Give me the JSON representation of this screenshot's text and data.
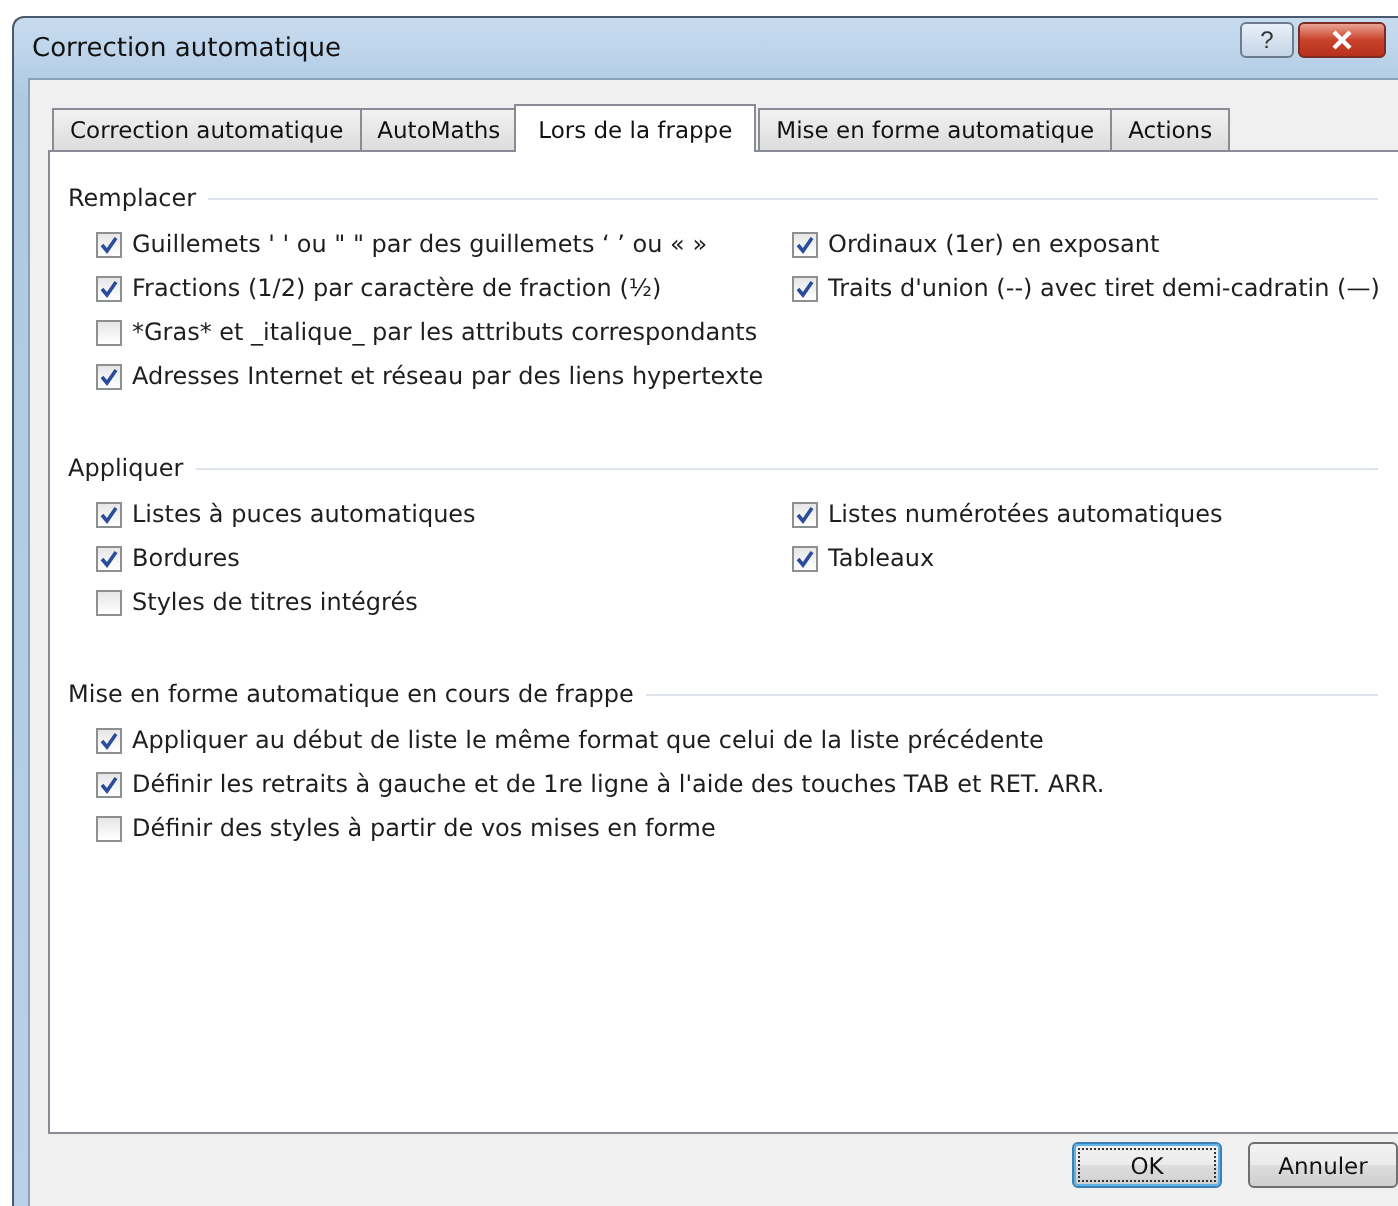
{
  "window": {
    "title": "Correction automatique",
    "help": "?"
  },
  "tabs": [
    {
      "label": "Correction automatique",
      "selected": false
    },
    {
      "label": "AutoMaths",
      "selected": false
    },
    {
      "label": "Lors de la frappe",
      "selected": true
    },
    {
      "label": "Mise en forme automatique",
      "selected": false
    },
    {
      "label": "Actions",
      "selected": false
    }
  ],
  "sections": [
    {
      "title": "Remplacer",
      "left": [
        {
          "label": "Guillemets ' ' ou \" \" par des guillemets ‘ ’ ou « »",
          "checked": true
        },
        {
          "label": "Fractions (1/2) par caractère de fraction (½)",
          "checked": true
        },
        {
          "label": "*Gras* et _italique_ par les attributs correspondants",
          "checked": false
        },
        {
          "label": "Adresses Internet et réseau par des liens hypertexte",
          "checked": true
        }
      ],
      "right": [
        {
          "label": "Ordinaux (1er) en exposant",
          "checked": true
        },
        {
          "label": "Traits d'union (--) avec tiret demi-cadratin (—)",
          "checked": true
        }
      ]
    },
    {
      "title": "Appliquer",
      "left": [
        {
          "label": "Listes à puces automatiques",
          "checked": true
        },
        {
          "label": "Bordures",
          "checked": true
        },
        {
          "label": "Styles de titres intégrés",
          "checked": false
        }
      ],
      "right": [
        {
          "label": "Listes numérotées automatiques",
          "checked": true
        },
        {
          "label": "Tableaux",
          "checked": true
        }
      ]
    },
    {
      "title": "Mise en forme automatique en cours de frappe",
      "left": [
        {
          "label": "Appliquer au début de liste le même format que celui de la liste précédente",
          "checked": true
        },
        {
          "label": "Définir les retraits à gauche et de 1re ligne à l'aide des touches TAB et RET. ARR.",
          "checked": true
        },
        {
          "label": "Définir des styles à partir de vos mises en forme",
          "checked": false
        }
      ]
    }
  ],
  "buttons": [
    {
      "label": "OK",
      "default": true
    },
    {
      "label": "Annuler",
      "default": false
    }
  ]
}
